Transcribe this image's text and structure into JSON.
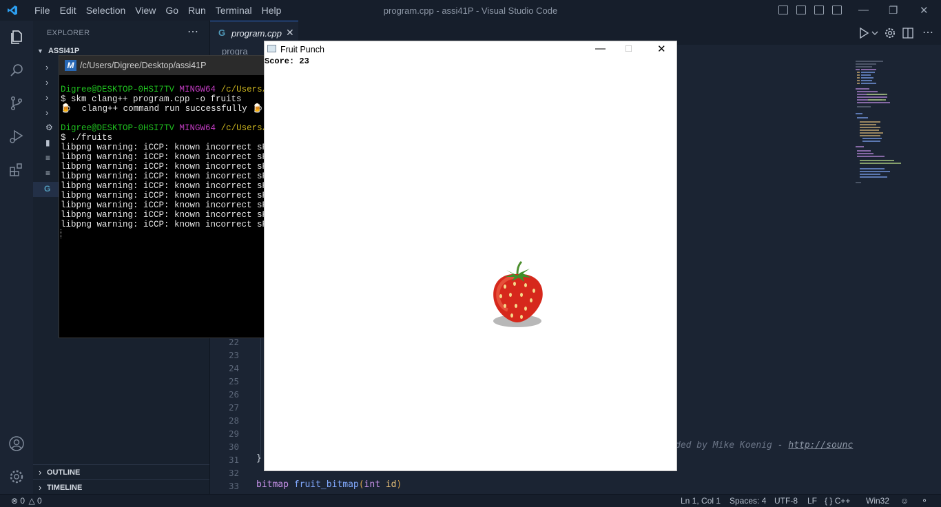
{
  "titlebar": {
    "menu": [
      "File",
      "Edit",
      "Selection",
      "View",
      "Go",
      "Run",
      "Terminal",
      "Help"
    ],
    "window_title": "program.cpp - assi41P - Visual Studio Code"
  },
  "sidebar": {
    "title": "EXPLORER",
    "folder": "ASSI41P",
    "outline": "OUTLINE",
    "timeline": "TIMELINE"
  },
  "editor": {
    "tab_label": "program.cpp",
    "breadcrumb": "progra",
    "line_numbers": [
      "22",
      "23",
      "24",
      "25",
      "26",
      "27",
      "28",
      "29",
      "30",
      "31",
      "32",
      "33"
    ],
    "closing_brace": "}",
    "comment_fragment_text": "ded by Mike Koenig - ",
    "comment_fragment_link": "http://sounc",
    "func_keyword": "bitmap",
    "func_name": "fruit_bitmap",
    "func_paren_open": "(",
    "func_param_type": "int",
    "func_param_name": "id",
    "func_paren_close": ")"
  },
  "terminal": {
    "title": "/c/Users/Digree/Desktop/assi41P",
    "user_host": "Digree@DESKTOP-0HSI7TV",
    "shell": "MINGW64",
    "path": "/c/Users/Dig",
    "cmd1": "$ skm clang++ program.cpp -o fruits",
    "result1": "🍺  clang++ command run successfully 🍺",
    "cmd2": "$ ./fruits",
    "warning": "libpng warning: iCCP: known incorrect sRGB",
    "warning_count": 9
  },
  "game": {
    "title": "Fruit Punch",
    "score_text": "Score: 23",
    "fruit": "strawberry-image"
  },
  "statusbar": {
    "errors": "0",
    "warnings": "0",
    "position": "Ln 1, Col 1",
    "spaces": "Spaces: 4",
    "encoding": "UTF-8",
    "eol": "LF",
    "language": "C++",
    "platform": "Win32"
  },
  "colors": {
    "background": "#1b2433",
    "accent": "#2f6dd1",
    "terminal_green": "#1fc21f",
    "terminal_magenta": "#c23cc2",
    "terminal_yellow": "#c9b31e"
  }
}
